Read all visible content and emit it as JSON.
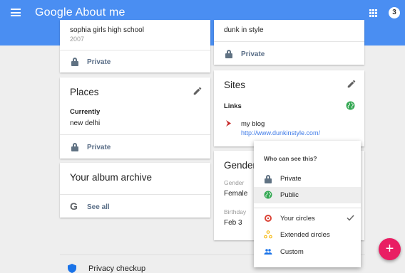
{
  "header": {
    "brand": "Google",
    "app_title": "About me",
    "notification_count": "3"
  },
  "cards": {
    "education": {
      "school": "sophia girls high school",
      "year": "2007",
      "visibility": "Private"
    },
    "bragging": {
      "value": "dunk in style",
      "visibility": "Private"
    },
    "places": {
      "title": "Places",
      "label": "Currently",
      "value": "new delhi",
      "visibility": "Private"
    },
    "sites": {
      "title": "Sites",
      "label": "Links",
      "link_name": "my blog",
      "link_url": "http://www.dunkinstyle.com/"
    },
    "album": {
      "title": "Your album archive",
      "action": "See all"
    },
    "gender": {
      "title": "Gender,",
      "gender_label": "Gender",
      "gender_value": "Female",
      "birthday_label": "Birthday",
      "birthday_value": "Feb 3"
    }
  },
  "footer": {
    "privacy_checkup": "Privacy checkup"
  },
  "visibility_menu": {
    "title": "Who can see this?",
    "options": [
      {
        "label": "Private",
        "icon": "lock-icon"
      },
      {
        "label": "Public",
        "icon": "globe-icon",
        "highlighted": true
      },
      {
        "label": "Your circles",
        "icon": "circles-icon",
        "checked": true
      },
      {
        "label": "Extended circles",
        "icon": "extended-circles-icon"
      },
      {
        "label": "Custom",
        "icon": "custom-people-icon"
      }
    ]
  },
  "fab": {
    "symbol": "+"
  },
  "colors": {
    "header_blue": "#4a8ef2",
    "fab_pink": "#e91e63",
    "link_blue": "#3b78e7",
    "globe_green": "#34a853"
  }
}
